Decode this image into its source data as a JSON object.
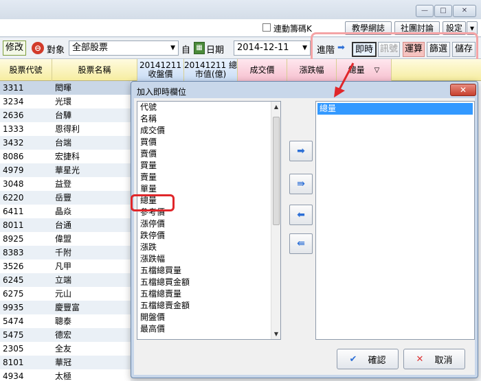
{
  "window": {
    "minimize": "—",
    "maximize": "□",
    "close": "✕"
  },
  "toprow": {
    "checkbox_label": "連動籌碼K",
    "buttons": [
      "教學網誌",
      "社團討論",
      "設定"
    ],
    "dropdown": "▾"
  },
  "toolbar": {
    "edit": "修改",
    "target_label": "對象",
    "target_value": "全部股票",
    "self_label": "自",
    "date_label": "日期",
    "date_value": "2014-12-11",
    "advance_label": "進階",
    "advance_arrow": "➡",
    "modes": [
      "即時",
      "訊號",
      "運算",
      "篩選",
      "儲存"
    ]
  },
  "table": {
    "headers": [
      "股票代號",
      "股票名稱",
      "20141211 收盤價",
      "20141211 總市值(億)",
      "成交價",
      "漲跌幅",
      "總量"
    ],
    "rows": [
      {
        "code": "3311",
        "name": "閎暉"
      },
      {
        "code": "3234",
        "name": "光環"
      },
      {
        "code": "2636",
        "name": "台驊"
      },
      {
        "code": "1333",
        "name": "恩得利"
      },
      {
        "code": "3432",
        "name": "台端"
      },
      {
        "code": "8086",
        "name": "宏捷科"
      },
      {
        "code": "4979",
        "name": "華星光"
      },
      {
        "code": "3048",
        "name": "益登"
      },
      {
        "code": "6220",
        "name": "岳豐"
      },
      {
        "code": "6411",
        "name": "晶焱"
      },
      {
        "code": "8011",
        "name": "台通"
      },
      {
        "code": "8925",
        "name": "偉盟"
      },
      {
        "code": "8383",
        "name": "千附"
      },
      {
        "code": "3526",
        "name": "凡甲"
      },
      {
        "code": "6245",
        "name": "立端"
      },
      {
        "code": "6275",
        "name": "元山"
      },
      {
        "code": "9935",
        "name": "慶豐富"
      },
      {
        "code": "5474",
        "name": "聰泰"
      },
      {
        "code": "5475",
        "name": "德宏"
      },
      {
        "code": "2305",
        "name": "全友"
      },
      {
        "code": "8101",
        "name": "華冠"
      },
      {
        "code": "4934",
        "name": "太極"
      }
    ]
  },
  "dialog": {
    "title": "加入即時欄位",
    "close": "✕",
    "available": [
      "代號",
      "名稱",
      "成交價",
      "買價",
      "賣價",
      "買量",
      "賣量",
      "單量",
      "總量",
      "參考價",
      "漲停價",
      "跌停價",
      "漲跌",
      "漲跌幅",
      "五檔總買量",
      "五檔總買金額",
      "五檔總賣量",
      "五檔總賣金額",
      "開盤價",
      "最高價"
    ],
    "selected": [
      "總量"
    ],
    "arrows": [
      "➡",
      "⇛",
      "⬅",
      "⇚"
    ],
    "ok": "確認",
    "cancel": "取消"
  }
}
